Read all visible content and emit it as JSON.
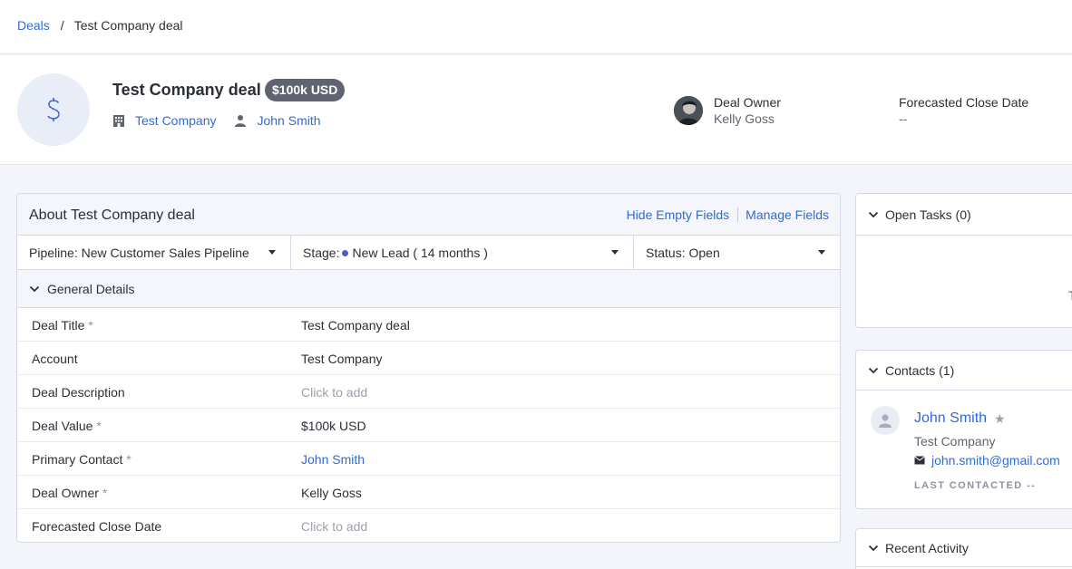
{
  "breadcrumb": {
    "root": "Deals",
    "separator": "/",
    "current": "Test Company deal"
  },
  "deal": {
    "title": "Test Company deal",
    "value_badge": "$100k USD",
    "company": "Test Company",
    "contact": "John Smith",
    "owner_label": "Deal Owner",
    "owner_name": "Kelly Goss",
    "close_label": "Forecasted Close Date",
    "close_value": "--"
  },
  "about": {
    "title": "About Test Company deal",
    "hide_empty": "Hide Empty Fields",
    "manage_fields": "Manage Fields",
    "pipeline_label": "Pipeline:",
    "pipeline_value": "New Customer Sales Pipeline",
    "stage_label": "Stage:",
    "stage_value": "New Lead ( 14 months )",
    "status_label": "Status:",
    "status_value": "Open",
    "section": "General Details",
    "fields": [
      {
        "name": "Deal Title",
        "required": "*",
        "value": "Test Company deal"
      },
      {
        "name": "Account",
        "required": "",
        "value": "Test Company"
      },
      {
        "name": "Deal Description",
        "required": "",
        "value": "Click to add"
      },
      {
        "name": "Deal Value",
        "required": "*",
        "value": "$100k USD"
      },
      {
        "name": "Primary Contact",
        "required": "*",
        "value": "John Smith"
      },
      {
        "name": "Deal Owner",
        "required": "*",
        "value": "Kelly Goss"
      },
      {
        "name": "Forecasted Close Date",
        "required": "",
        "value": "Click to add"
      }
    ]
  },
  "sidebar": {
    "open_tasks": "Open Tasks (0)",
    "tasks_peek": "T",
    "contacts": "Contacts (1)",
    "contact_name": "John Smith",
    "contact_star": "★",
    "contact_company": "Test Company",
    "contact_email": "john.smith@gmail.com",
    "last_contacted": "LAST CONTACTED --",
    "recent_activity": "Recent Activity"
  },
  "colors": {
    "accent": "#2f6bd6",
    "badge": "#5f6470",
    "stage_dot": "#4a5fc1"
  }
}
